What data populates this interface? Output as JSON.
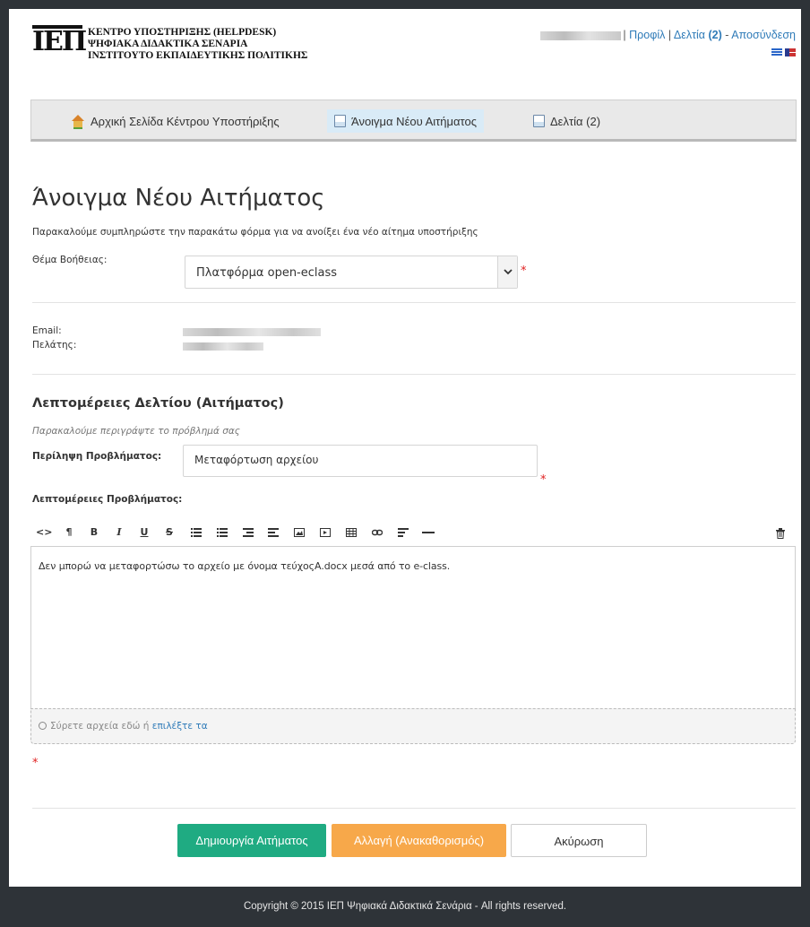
{
  "header": {
    "logo_mark": "ΙΕΠ",
    "logo_lines": [
      "ΚΕΝΤΡΟ ΥΠΟΣΤΗΡΙΞΗΣ (HELPDESK)",
      "ΨΗΦΙΑΚΑ ΔΙΔΑΚΤΙΚΑ ΣΕΝΑΡΙΑ",
      "ΙΝΣΤΙΤΟΥΤΟ ΕΚΠΑΙΔΕΥΤΙΚΗΣ ΠΟΛΙΤΙΚΗΣ"
    ],
    "separator": "|",
    "profile_link": "Προφίλ",
    "tickets_link": "Δελτία",
    "tickets_count": "(2)",
    "dash": "-",
    "logout_link": "Αποσύνδεση"
  },
  "nav": {
    "items": [
      {
        "label": "Αρχική Σελίδα Κέντρου Υποστήριξης",
        "icon": "home-icon"
      },
      {
        "label": "Άνοιγμα Νέου Αιτήματος",
        "icon": "new-ticket-icon"
      },
      {
        "label": "Δελτία (2)",
        "icon": "tickets-icon"
      }
    ]
  },
  "form": {
    "title": "Άνοιγμα Νέου Αιτήματος",
    "intro": "Παρακαλούμε συμπληρώστε την παρακάτω φόρμα για να ανοίξει ένα νέο αίτημα υποστήριξης",
    "help_topic_label": "Θέμα Βοήθειας:",
    "help_topic_value": "Πλατφόρμα open-eclass",
    "required_mark": "*",
    "email_label": "Email:",
    "client_label": "Πελάτης:",
    "details_title": "Λεπτομέρειες Δελτίου (Αιτήματος)",
    "details_sub": "Παρακαλούμε περιγράψτε το πρόβλημά σας",
    "summary_label": "Περίληψη Προβλήματος:",
    "summary_value": "Μεταφόρτωση αρχείου",
    "problem_label": "Λεπτομέρειες Προβλήματος:",
    "editor_text": "Δεν μπορώ να μεταφορτώσω το αρχείο με όνομα τεύχοςΑ.docx μεσά από το e-class.",
    "dropzone_text": "Σύρετε αρχεία εδώ ή",
    "dropzone_link": "επιλέξτε τα"
  },
  "toolbar": [
    "code-icon",
    "paragraph-icon",
    "bold-icon",
    "italic-icon",
    "underline-icon",
    "strikethrough-icon",
    "unordered-list-icon",
    "ordered-list-icon",
    "outdent-icon",
    "indent-icon",
    "image-icon",
    "video-icon",
    "table-icon",
    "link-icon",
    "align-icon",
    "horizontal-rule-icon",
    "trash-icon"
  ],
  "toolbar_text": {
    "bold": "B",
    "italic": "I",
    "underline": "U",
    "strike": "S",
    "paragraph": "¶",
    "code": "<>"
  },
  "buttons": {
    "create": "Δημιουργία Αιτήματος",
    "reset": "Αλλαγή (Ανακαθορισμός)",
    "cancel": "Ακύρωση"
  },
  "footer": "Copyright © 2015 ΙΕΠ Ψηφιακά Διδακτικά Σενάρια - All rights reserved."
}
